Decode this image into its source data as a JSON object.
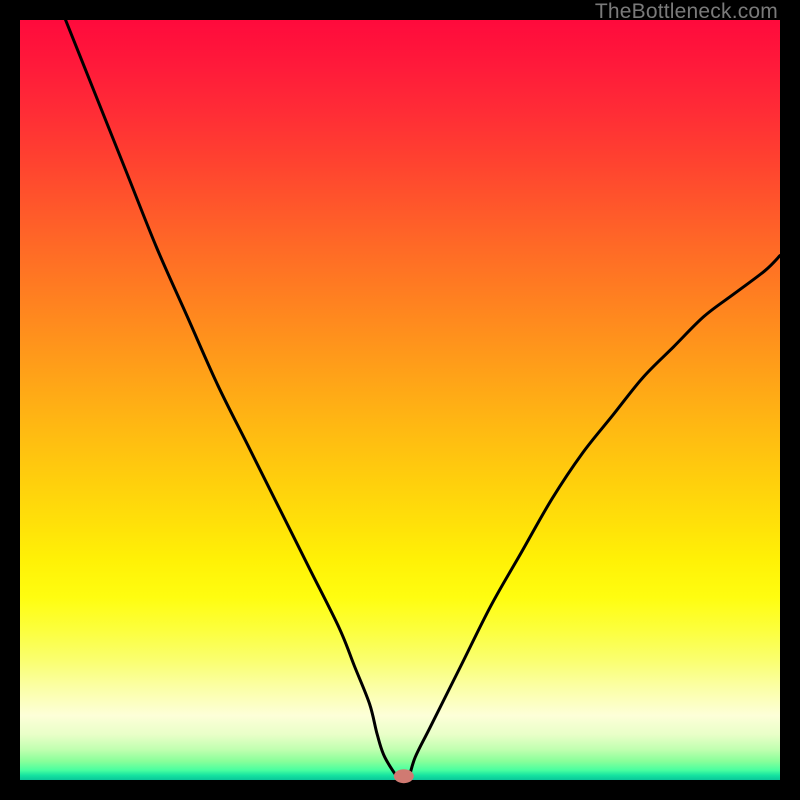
{
  "watermark": "TheBottleneck.com",
  "colors": {
    "frame": "#000000",
    "curve": "#000000",
    "marker": "#d07a72",
    "gradient_stops": [
      "#ff0a3c",
      "#ff1a3a",
      "#ff2c36",
      "#ff4030",
      "#ff552b",
      "#ff6a26",
      "#ff7e21",
      "#ff921c",
      "#ffa617",
      "#ffba12",
      "#ffcd0d",
      "#ffe009",
      "#fff106",
      "#fffd10",
      "#fcff3a",
      "#faff6c",
      "#fbffa8",
      "#fdffd8",
      "#e9ffc8",
      "#c0ffb0",
      "#8aff9a",
      "#4affa0",
      "#15e3a0",
      "#0ac79a"
    ]
  },
  "chart_data": {
    "type": "line",
    "title": "",
    "xlabel": "",
    "ylabel": "",
    "xlim": [
      0,
      100
    ],
    "ylim": [
      0,
      100
    ],
    "grid": false,
    "legend": false,
    "series": [
      {
        "name": "bottleneck-curve",
        "x": [
          6,
          10,
          14,
          18,
          22,
          26,
          30,
          34,
          38,
          42,
          44,
          46,
          47,
          48,
          50,
          51,
          52,
          54,
          58,
          62,
          66,
          70,
          74,
          78,
          82,
          86,
          90,
          94,
          98,
          100
        ],
        "values": [
          100,
          90,
          80,
          70,
          61,
          52,
          44,
          36,
          28,
          20,
          15,
          10,
          6,
          3,
          0,
          0,
          3,
          7,
          15,
          23,
          30,
          37,
          43,
          48,
          53,
          57,
          61,
          64,
          67,
          69
        ]
      }
    ],
    "annotations": [
      {
        "name": "optimal-marker",
        "x": 50.5,
        "y": 0.5
      }
    ]
  }
}
